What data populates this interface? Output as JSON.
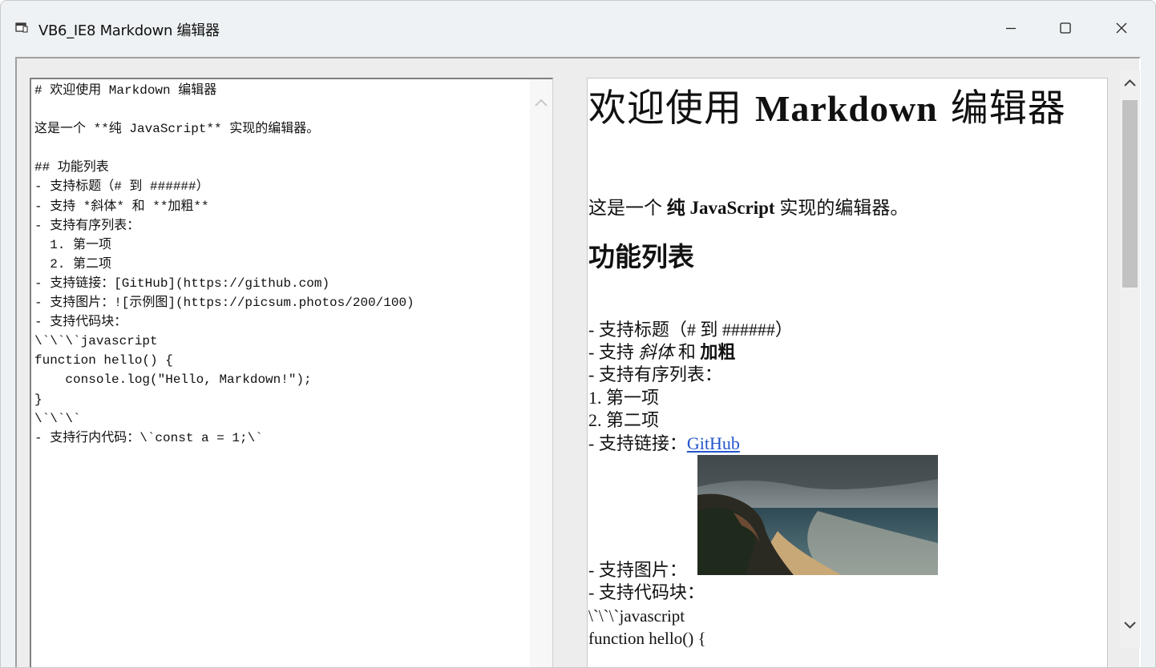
{
  "window": {
    "title": "VB6_IE8 Markdown 编辑器",
    "icons": [
      "app-window-icon",
      "minimize-icon",
      "maximize-icon",
      "close-icon"
    ]
  },
  "editor": {
    "lines": [
      "# 欢迎使用 Markdown 编辑器",
      "",
      "这是一个 **纯 JavaScript** 实现的编辑器。",
      "",
      "## 功能列表",
      "- 支持标题（# 到 ######）",
      "- 支持 *斜体* 和 **加粗**",
      "- 支持有序列表：",
      "  1. 第一项",
      "  2. 第二项",
      "- 支持链接：[GitHub](https://github.com)",
      "- 支持图片：![示例图](https://picsum.photos/200/100)",
      "- 支持代码块：",
      "\\`\\`\\`javascript",
      "function hello() {",
      "    console.log(\"Hello, Markdown!\");",
      "}",
      "\\`\\`\\`",
      "- 支持行内代码：\\`const a = 1;\\`"
    ]
  },
  "preview": {
    "h1_pre": "欢迎使用 ",
    "h1_bold": "Markdown",
    "h1_post": " 编辑器",
    "p_pre": "这是一个 ",
    "p_bold": "纯 JavaScript",
    "p_post": " 实现的编辑器。",
    "h2": "功能列表",
    "item1": "- 支持标题（# 到 ######）",
    "item2_pre": "- 支持 ",
    "item2_italic": "斜体",
    "item2_mid": " 和 ",
    "item2_bold": "加粗",
    "item3": "- 支持有序列表：",
    "item4": "1. 第一项",
    "item5": "2. 第二项",
    "item6_pre": "- 支持链接：",
    "item6_link": "GitHub",
    "item7": "- 支持图片：",
    "item8": "- 支持代码块：",
    "item9": "\\`\\`\\`javascript",
    "item10": "function hello() {"
  },
  "colors": {
    "link": "#2255cc",
    "chrome": "#eef2f4"
  }
}
